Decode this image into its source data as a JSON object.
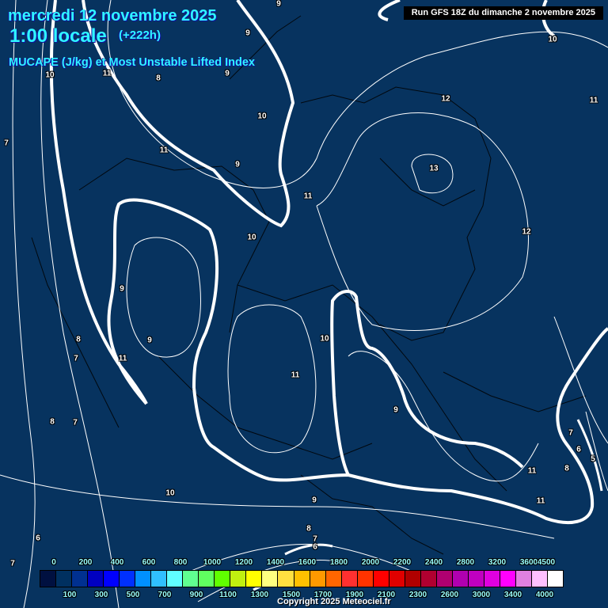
{
  "header": {
    "date": "mercredi 12 novembre 2025",
    "time": "1:00 locale",
    "lead": "(+222h)",
    "parameter": "MUCAPE (J/kg) et Most Unstable Lifted Index",
    "run": "Run GFS 18Z du dimanche 2 novembre 2025"
  },
  "contour_labels": [
    "9",
    "9",
    "10",
    "10",
    "11",
    "8",
    "9",
    "12",
    "11",
    "7",
    "10",
    "11",
    "9",
    "13",
    "11",
    "12",
    "10",
    "9",
    "9",
    "8",
    "7",
    "11",
    "10",
    "11",
    "9",
    "8",
    "7",
    "7",
    "6",
    "5",
    "8",
    "11",
    "10",
    "11",
    "9",
    "8",
    "7",
    "6",
    "6",
    "7"
  ],
  "legend": {
    "colors": [
      "#001040",
      "#003060",
      "#003090",
      "#0000c0",
      "#0000ff",
      "#0030ff",
      "#0090ff",
      "#30c0ff",
      "#60ffff",
      "#60ff90",
      "#60ff60",
      "#60ff00",
      "#c0f010",
      "#ffff00",
      "#ffff80",
      "#ffe040",
      "#ffc000",
      "#ff9900",
      "#ff6600",
      "#ff3030",
      "#ff3300",
      "#ff0000",
      "#e00000",
      "#b00000",
      "#b00030",
      "#b00070",
      "#b000b0",
      "#c000c0",
      "#e000e0",
      "#ff00ff",
      "#e080e0",
      "#ffc0ff",
      "#ffffff"
    ],
    "top_ticks": [
      "0",
      "200",
      "400",
      "600",
      "800",
      "1000",
      "1200",
      "1400",
      "1600",
      "1800",
      "2000",
      "2200",
      "2400",
      "2800",
      "3200",
      "3600",
      "4500"
    ],
    "bottom_ticks": [
      "100",
      "300",
      "500",
      "700",
      "900",
      "1100",
      "1300",
      "1500",
      "1700",
      "1900",
      "2100",
      "2300",
      "2600",
      "3000",
      "3400",
      "4000"
    ]
  },
  "copyright": "Copyright 2025 Meteociel.fr"
}
